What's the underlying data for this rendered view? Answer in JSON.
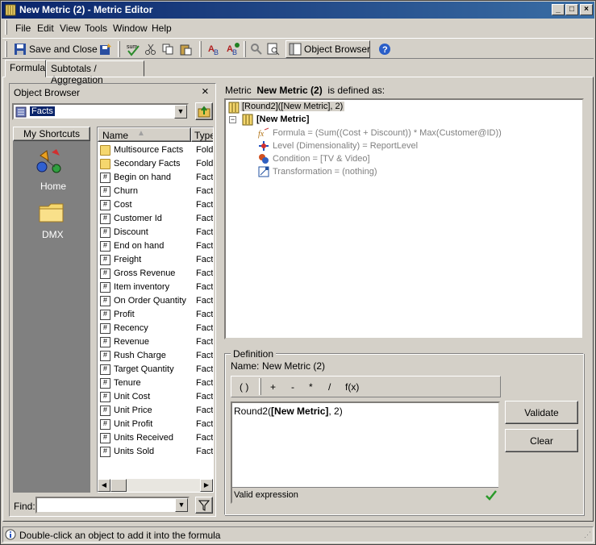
{
  "window": {
    "title": "New Metric (2) - Metric Editor",
    "min_label": "_",
    "max_label": "□",
    "close_label": "×"
  },
  "menu": [
    "File",
    "Edit",
    "View",
    "Tools",
    "Window",
    "Help"
  ],
  "toolbar": {
    "save_close_label": "Save and Close",
    "object_browser_label": "Object Browser"
  },
  "tabs": [
    "Formula",
    "Subtotals / Aggregation"
  ],
  "object_browser": {
    "title": "Object Browser",
    "close_label": "×",
    "folder_value": "Facts",
    "shortcuts_header": "My Shortcuts",
    "shortcuts": [
      {
        "label": "Home",
        "icon": "home-shapes-icon"
      },
      {
        "label": "DMX",
        "icon": "folder-icon"
      }
    ],
    "columns": [
      "Name",
      "Type"
    ],
    "items": [
      {
        "name": "Multisource Facts",
        "type": "Folde",
        "icon": "folder-icon"
      },
      {
        "name": "Secondary Facts",
        "type": "Folde",
        "icon": "folder-icon"
      },
      {
        "name": "Begin on hand",
        "type": "Fact",
        "icon": "fact-icon"
      },
      {
        "name": "Churn",
        "type": "Fact",
        "icon": "fact-icon"
      },
      {
        "name": "Cost",
        "type": "Fact",
        "icon": "fact-icon"
      },
      {
        "name": "Customer Id",
        "type": "Fact",
        "icon": "fact-icon"
      },
      {
        "name": "Discount",
        "type": "Fact",
        "icon": "fact-icon"
      },
      {
        "name": "End on hand",
        "type": "Fact",
        "icon": "fact-icon"
      },
      {
        "name": "Freight",
        "type": "Fact",
        "icon": "fact-icon"
      },
      {
        "name": "Gross Revenue",
        "type": "Fact",
        "icon": "fact-icon"
      },
      {
        "name": "Item inventory",
        "type": "Fact",
        "icon": "fact-icon"
      },
      {
        "name": "On Order Quantity",
        "type": "Fact",
        "icon": "fact-icon"
      },
      {
        "name": "Profit",
        "type": "Fact",
        "icon": "fact-icon"
      },
      {
        "name": "Recency",
        "type": "Fact",
        "icon": "fact-icon"
      },
      {
        "name": "Revenue",
        "type": "Fact",
        "icon": "fact-icon"
      },
      {
        "name": "Rush Charge",
        "type": "Fact",
        "icon": "fact-icon"
      },
      {
        "name": "Target Quantity",
        "type": "Fact",
        "icon": "fact-icon"
      },
      {
        "name": "Tenure",
        "type": "Fact",
        "icon": "fact-icon"
      },
      {
        "name": "Unit Cost",
        "type": "Fact",
        "icon": "fact-icon"
      },
      {
        "name": "Unit Price",
        "type": "Fact",
        "icon": "fact-icon"
      },
      {
        "name": "Unit Profit",
        "type": "Fact",
        "icon": "fact-icon"
      },
      {
        "name": "Units Received",
        "type": "Fact",
        "icon": "fact-icon"
      },
      {
        "name": "Units Sold",
        "type": "Fact",
        "icon": "fact-icon"
      }
    ],
    "find_label": "Find:",
    "find_value": ""
  },
  "metric": {
    "prefix": "Metric",
    "name": "New Metric (2)",
    "suffix": "is defined as:",
    "root": "[Round2]([New Metric], 2)",
    "child": "[New Metric]",
    "props": [
      {
        "text": "Formula = (Sum((Cost + Discount)) * Max(Customer@ID))",
        "icon": "formula-icon"
      },
      {
        "text": "Level (Dimensionality) = ReportLevel",
        "icon": "level-icon"
      },
      {
        "text": "Condition = [TV & Video]",
        "icon": "condition-icon"
      },
      {
        "text": "Transformation = (nothing)",
        "icon": "transformation-icon"
      }
    ],
    "expander": "−"
  },
  "definition": {
    "legend": "Definition",
    "name_label": "Name:",
    "name_value": "New Metric (2)",
    "operators": [
      "( )",
      "+",
      "-",
      "*",
      "/",
      "f(x)"
    ],
    "formula_prefix": "Round2(",
    "formula_bold": "[New Metric]",
    "formula_suffix": ", 2)",
    "status": "Valid expression",
    "validate_label": "Validate",
    "clear_label": "Clear"
  },
  "statusbar": {
    "text": "Double-click an object to add it into the formula"
  }
}
